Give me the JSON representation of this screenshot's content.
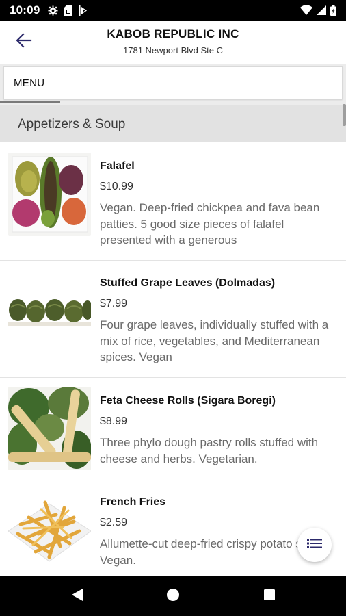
{
  "status_bar": {
    "time": "10:09",
    "left_icons": [
      "gear-icon",
      "sim-card-icon",
      "download-status-icon"
    ],
    "right_icons": [
      "wifi-icon",
      "signal-icon",
      "battery-icon"
    ]
  },
  "header": {
    "title": "KABOB REPUBLIC INC",
    "subtitle": "1781 Newport Blvd Ste C",
    "back_icon": "arrow-left-icon"
  },
  "tabs": [
    {
      "label": "MENU",
      "selected": true
    }
  ],
  "category": {
    "label": "Appetizers & Soup"
  },
  "items": [
    {
      "name": "Falafel",
      "price": "$10.99",
      "description": "Vegan. Deep-fried chickpea and fava bean patties. 5 good size pieces of falafel presented with a generous"
    },
    {
      "name": "Stuffed Grape Leaves (Dolmadas)",
      "price": "$7.99",
      "description": "Four grape leaves, individually stuffed with a mix of rice, vegetables, and Mediterranean spices. Vegan"
    },
    {
      "name": "Feta Cheese Rolls (Sigara Boregi)",
      "price": "$8.99",
      "description": "Three phylo dough pastry rolls stuffed with cheese and herbs. Vegetarian."
    },
    {
      "name": "French Fries",
      "price": "$2.59",
      "description": "Allumette-cut deep-fried crispy potato strips. Vegan."
    }
  ],
  "fab": {
    "icon": "list-icon"
  },
  "nav_bar": {
    "icons": [
      "back-triangle-icon",
      "home-circle-icon",
      "recents-square-icon"
    ]
  },
  "colors": {
    "accent": "#2c2a6b",
    "category_bg": "#e2e2e2",
    "description_text": "#6a6a6a"
  }
}
